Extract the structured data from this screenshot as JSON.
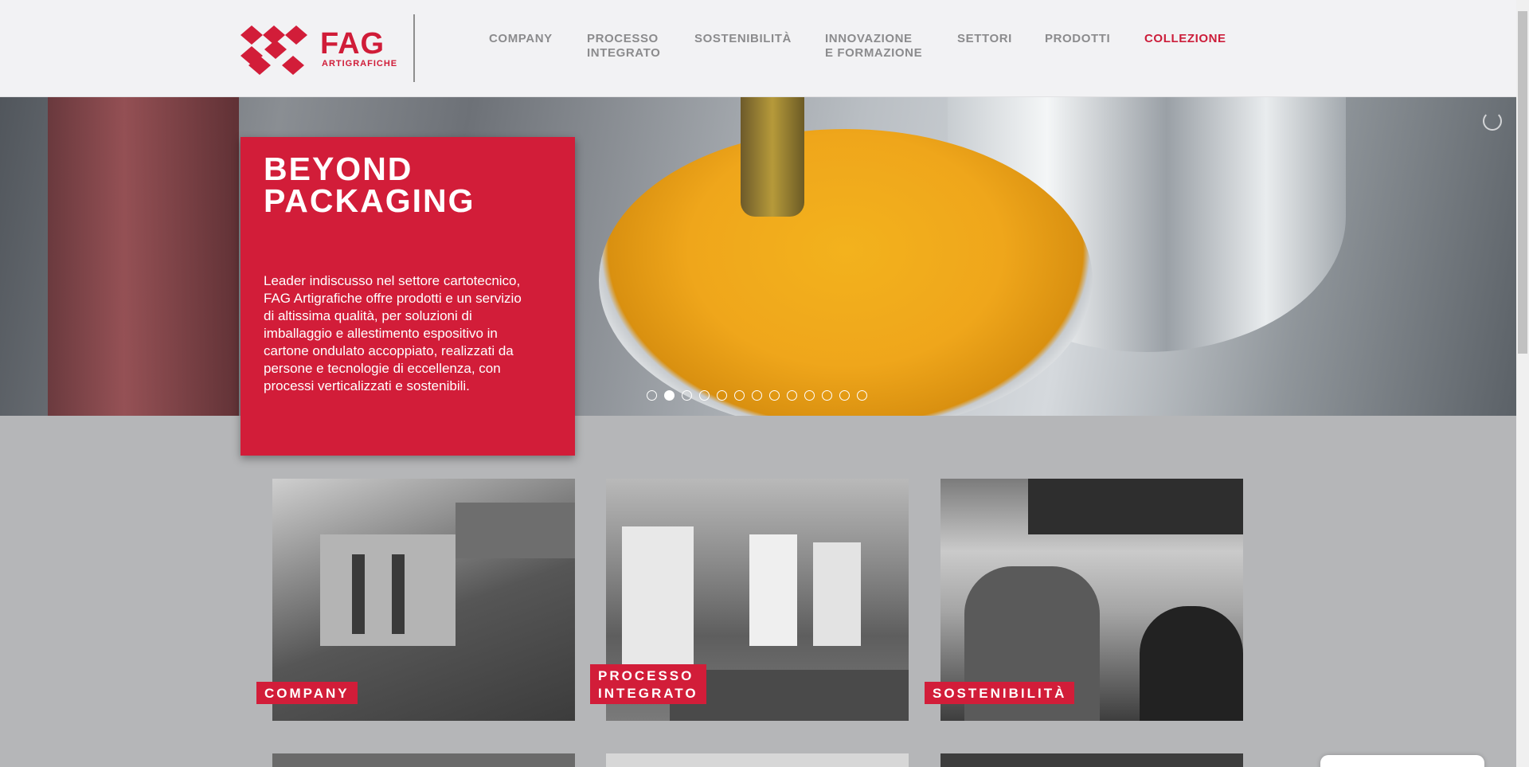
{
  "brand": {
    "name": "FAG",
    "subtitle": "ARTIGRAFICHE",
    "accent_color": "#d21d39"
  },
  "nav": {
    "items": [
      {
        "label": "COMPANY"
      },
      {
        "label": "PROCESSO\nINTEGRATO"
      },
      {
        "label": "SOSTENIBILITÀ"
      },
      {
        "label": "INNOVAZIONE\nE FORMAZIONE"
      },
      {
        "label": "SETTORI"
      },
      {
        "label": "PRODOTTI"
      },
      {
        "label": "COLLEZIONE",
        "active": true
      }
    ]
  },
  "hero": {
    "title": "BEYOND\nPACKAGING",
    "body": "Leader indiscusso nel settore cartotecnico, FAG Artigrafiche offre prodotti e un servizio di altissima qualità, per soluzioni di imballaggio e allestimento espositivo in cartone ondulato accoppiato, realizzati da persone e tecnologie di eccellenza, con processi verticalizzati e sostenibili.",
    "slides_total": 13,
    "slide_active": 2
  },
  "cards": [
    {
      "label": "COMPANY"
    },
    {
      "label": "PROCESSO\nINTEGRATO"
    },
    {
      "label": "SOSTENIBILITÀ"
    }
  ]
}
